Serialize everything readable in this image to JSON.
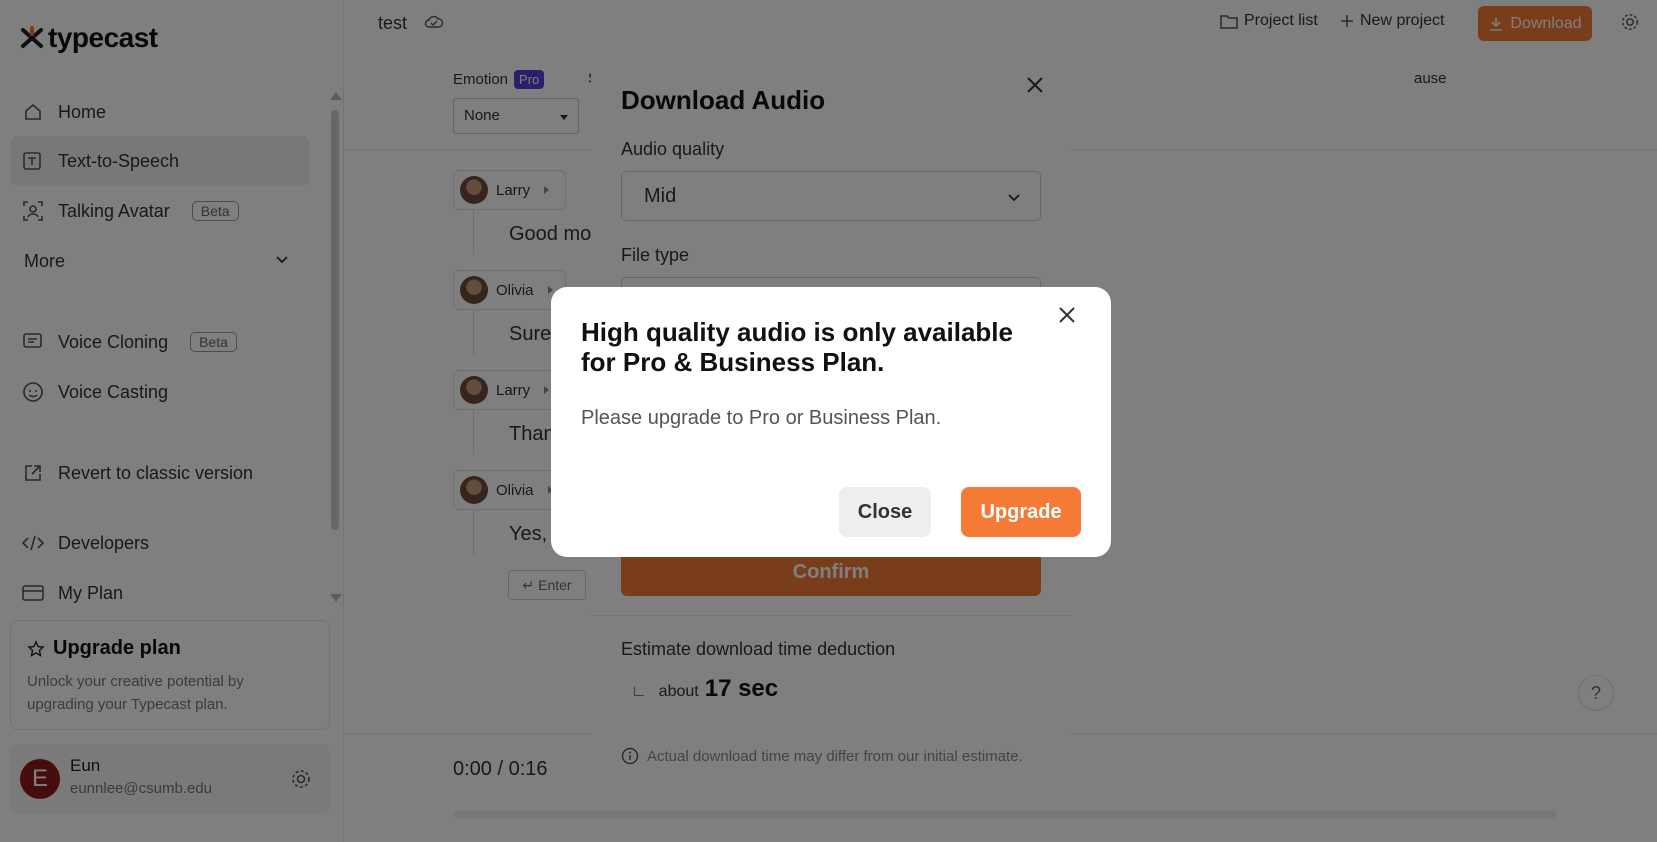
{
  "brand": {
    "name": "typecast",
    "accent": "#f47a36"
  },
  "sidebar": {
    "items": [
      {
        "label": "Home",
        "icon": "home-icon"
      },
      {
        "label": "Text-to-Speech",
        "icon": "tts-icon",
        "active": true
      },
      {
        "label": "Talking Avatar",
        "icon": "avatar-frame-icon",
        "badge": "Beta"
      },
      {
        "label": "More",
        "icon": "chevron-down-icon"
      },
      {
        "label": "Voice Cloning",
        "icon": "chat-icon",
        "badge": "Beta"
      },
      {
        "label": "Voice Casting",
        "icon": "face-icon"
      },
      {
        "label": "Revert to classic version",
        "icon": "external-link-icon"
      },
      {
        "label": "Developers",
        "icon": "code-icon"
      },
      {
        "label": "My Plan",
        "icon": "card-icon"
      }
    ],
    "upgrade": {
      "title": "Upgrade plan",
      "desc": "Unlock your creative potential by upgrading your Typecast plan."
    },
    "user": {
      "initial": "E",
      "name": "Eun",
      "email": "eunnlee@csumb.edu"
    }
  },
  "topbar": {
    "project_name": "test",
    "project_list": "Project list",
    "new_project": "New project",
    "download": "Download"
  },
  "toolbar": {
    "emotion_label": "Emotion",
    "pro_badge": "Pro",
    "emotion_value": "None",
    "partial_s": "S",
    "pause_label": "ause"
  },
  "script_lines": [
    {
      "speaker": "Larry",
      "text": "Good mo"
    },
    {
      "speaker": "Olivia",
      "text": "Sure"
    },
    {
      "speaker": "Larry",
      "text": "Than"
    },
    {
      "speaker": "Olivia",
      "text": "Yes,"
    }
  ],
  "editor": {
    "enter_label": "Enter",
    "help": "?"
  },
  "player": {
    "time": "0:00 / 0:16"
  },
  "download_modal": {
    "title": "Download Audio",
    "audio_quality_label": "Audio quality",
    "audio_quality_value": "Mid",
    "file_type_label": "File type",
    "confirm": "Confirm",
    "estimate_label": "Estimate download time deduction",
    "estimate_prefix": "about",
    "estimate_value": "17 sec",
    "note": "Actual download time may differ from our initial estimate."
  },
  "hq_modal": {
    "title": "High quality audio is only available for Pro & Business Plan.",
    "desc": "Please upgrade to Pro or Business Plan.",
    "close": "Close",
    "upgrade": "Upgrade"
  }
}
